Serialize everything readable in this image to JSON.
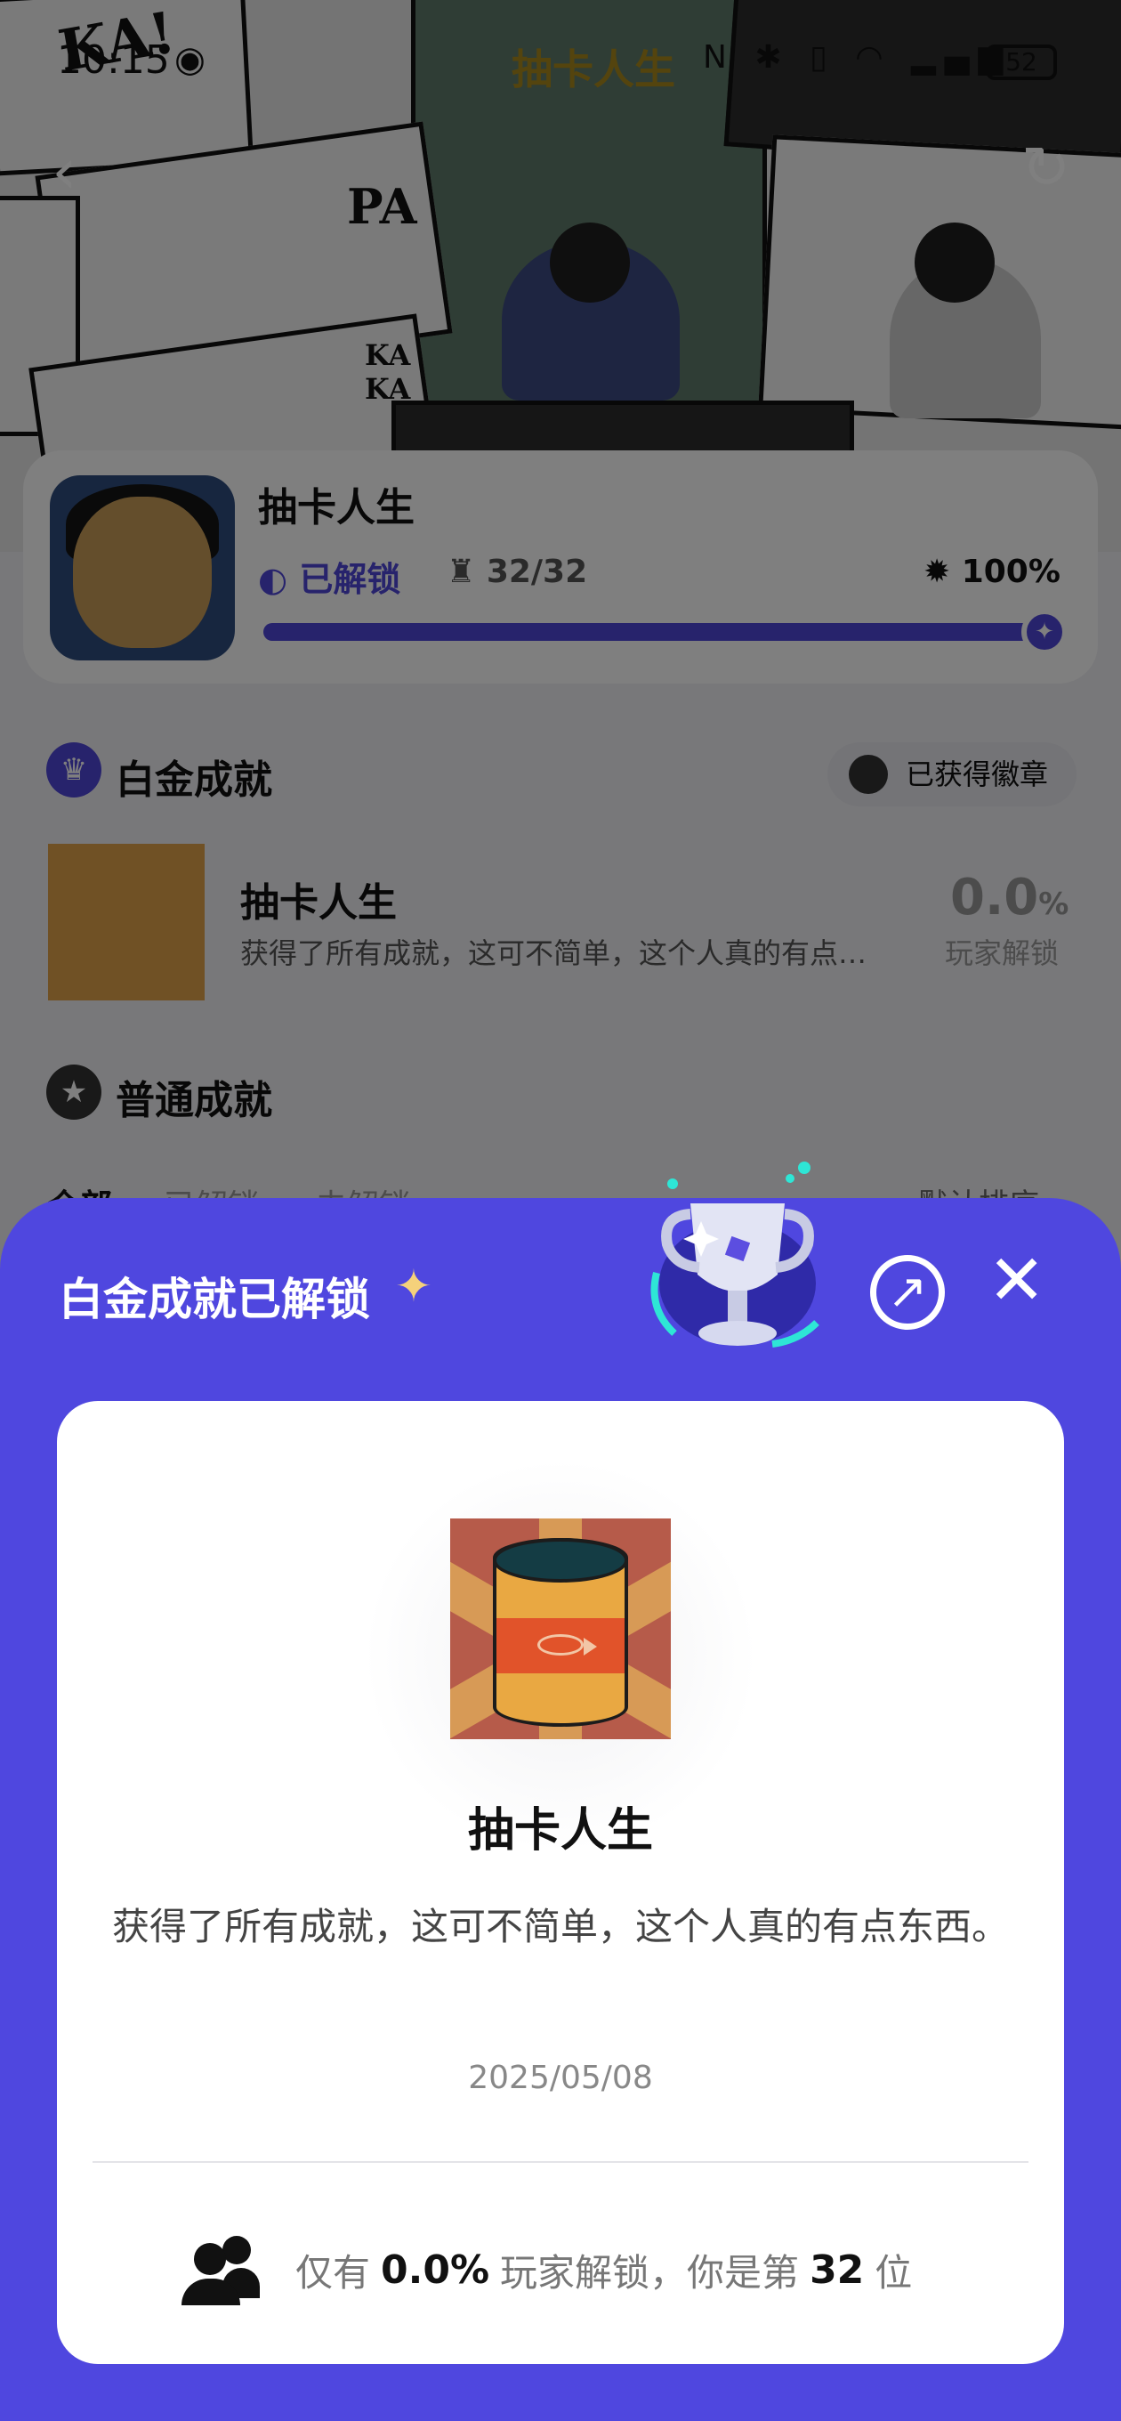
{
  "status_bar": {
    "time": "10:15",
    "app_title": "抽卡人生",
    "battery": "52"
  },
  "game_card": {
    "title": "抽卡人生",
    "unlock_status": "已解锁",
    "trophy_count": "32/32",
    "completion": "100%",
    "progress_fraction": 1.0
  },
  "platinum_section": {
    "title": "白金成就",
    "badge_button": "已获得徽章",
    "achievement": {
      "title": "抽卡人生",
      "description": "获得了所有成就，这可不简单，这个人真的有点…",
      "rate_value": "0.0",
      "rate_unit": "%",
      "rate_label": "玩家解锁"
    }
  },
  "normal_section": {
    "title": "普通成就",
    "tabs": [
      "全部",
      "已解锁",
      "未解锁"
    ],
    "sort_label": "默认排序"
  },
  "modal": {
    "title": "白金成就已解锁",
    "achievement_title": "抽卡人生",
    "description": "获得了所有成就，这可不简单，这个人真的有点东西。",
    "date": "2025/05/08",
    "footer_prefix": "仅有",
    "footer_rate": "0.0%",
    "footer_middle": "玩家解锁，你是第",
    "footer_rank": "32",
    "footer_suffix": "位"
  },
  "colors": {
    "accent": "#4f47df",
    "sheet_background": "#4f47df",
    "card_background": "#ffffff"
  },
  "icons": [
    "back-icon",
    "share-icon",
    "trophy-icon",
    "medal-icon",
    "close-icon",
    "people-icon",
    "sparkle-icon"
  ]
}
